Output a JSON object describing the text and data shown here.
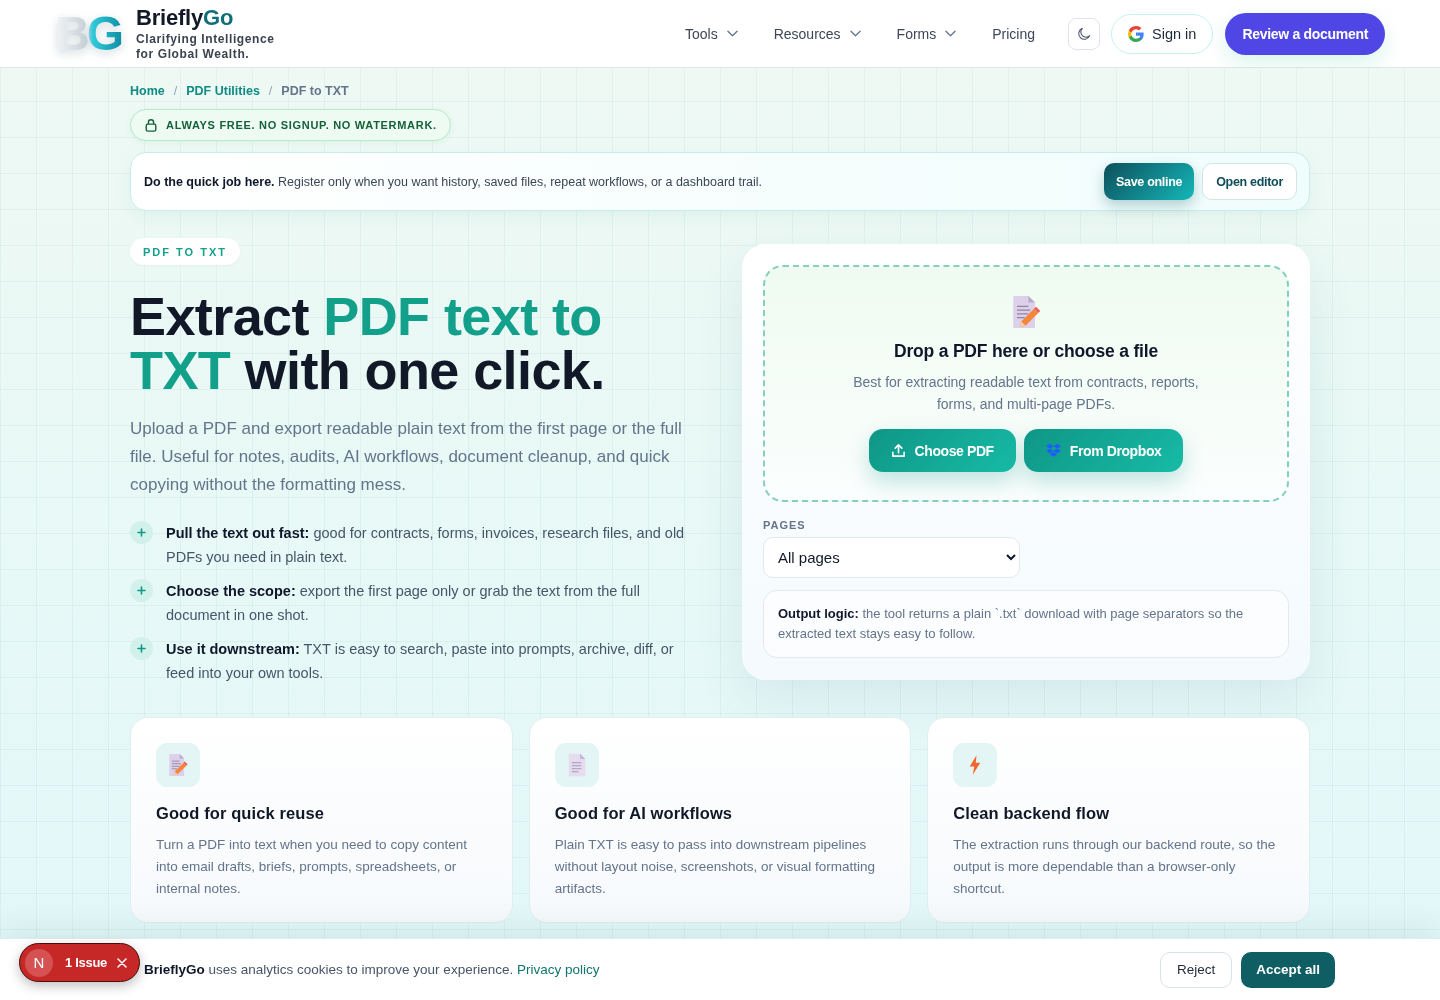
{
  "header": {
    "logo_mark": "BG",
    "brand_name": [
      {
        "text": "Briefly",
        "accent": false
      },
      {
        "text": "Go",
        "accent": true
      }
    ],
    "tagline": "Clarifying Intelligence for Global Wealth.",
    "nav": [
      {
        "label": "Tools",
        "has_menu": true
      },
      {
        "label": "Resources",
        "has_menu": true
      },
      {
        "label": "Forms",
        "has_menu": true
      },
      {
        "label": "Pricing",
        "has_menu": false
      }
    ],
    "sign_in": "Sign in",
    "cta": "Review a document"
  },
  "breadcrumb": {
    "items": [
      {
        "label": "Home",
        "current": false
      },
      {
        "label": "PDF Utilities",
        "current": false
      },
      {
        "label": "PDF to TXT",
        "current": true
      }
    ],
    "separators": [
      "/",
      "/"
    ]
  },
  "notice": "ALWAYS FREE. NO SIGNUP. NO WATERMARK.",
  "banner": {
    "text": "**Do the quick job here.** Register only when you want history, saved files, repeat workflows, or a dashboard trail.",
    "buttons": [
      {
        "label": "Save online",
        "kind": "primary"
      },
      {
        "label": "Open editor",
        "kind": "secondary"
      }
    ]
  },
  "hero": {
    "eyebrow": "PDF TO TXT",
    "headline": [
      {
        "text": "Extract ",
        "accent": false
      },
      {
        "text": "PDF text to TXT",
        "accent": true
      },
      {
        "text": " with one click.",
        "accent": false
      }
    ],
    "intro": "Upload a PDF and export readable plain text from the first page or the full file. Useful for notes, audits, AI workflows, document cleanup, and quick copying without the formatting mess.",
    "points": [
      "**Pull the text out fast:** good for contracts, forms, invoices, research files, and old PDFs you need in plain text.",
      "**Choose the scope:** export the first page only or grab the text from the full document in one shot.",
      "**Use it downstream:** TXT is easy to search, paste into prompts, archive, diff, or feed into your own tools."
    ]
  },
  "upload": {
    "title": "Drop a PDF here or choose a file",
    "description": "Best for extracting readable text from contracts, reports, forms, and multi-page PDFs.",
    "buttons": [
      {
        "label": "Choose PDF",
        "kind": "device"
      },
      {
        "label": "From Dropbox",
        "kind": "dropbox"
      }
    ],
    "pages": {
      "label": "PAGES",
      "value": "All pages"
    },
    "note": "**Output logic:** the tool returns a plain `.txt` download with page separators so the extracted text stays easy to follow."
  },
  "features": [
    {
      "kind": "memo",
      "title": "Good for quick reuse",
      "text": "Turn a PDF into text when you need to copy content into email drafts, briefs, prompts, spreadsheets, or internal notes."
    },
    {
      "kind": "document",
      "title": "Good for AI workflows",
      "text": "Plain TXT is easy to pass into downstream pipelines without layout noise, screenshots, or visual formatting artifacts."
    },
    {
      "kind": "bolt",
      "title": "Clean backend flow",
      "text": "The extraction runs through our backend route, so the output is more dependable than a browser-only shortcut."
    }
  ],
  "cookie_bar": {
    "text": "**BrieflyGo** uses analytics cookies to improve your experience.",
    "link": "Privacy policy",
    "buttons": [
      {
        "label": "Reject",
        "kind": "secondary"
      },
      {
        "label": "Accept all",
        "kind": "primary"
      }
    ]
  },
  "dev_badge": {
    "logo": "N",
    "label": "1 Issue"
  }
}
